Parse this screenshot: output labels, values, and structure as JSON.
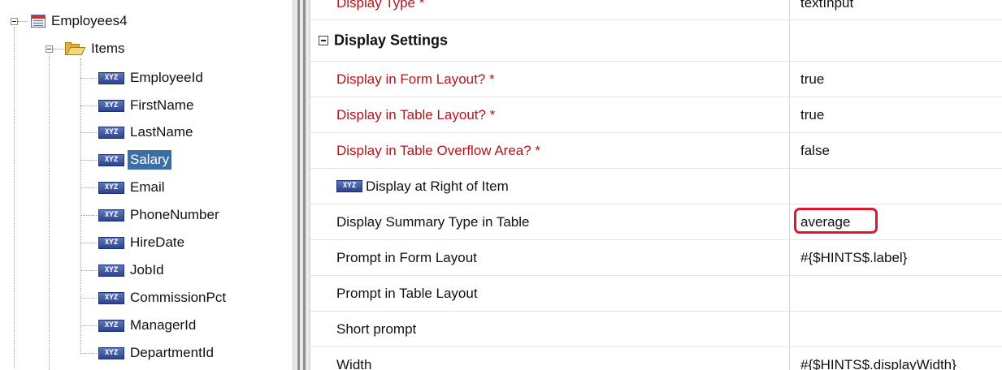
{
  "tree": {
    "root": {
      "label": "Employees4"
    },
    "folder": {
      "label": "Items"
    },
    "items": [
      {
        "label": "EmployeeId"
      },
      {
        "label": "FirstName"
      },
      {
        "label": "LastName"
      },
      {
        "label": "Salary",
        "selected": true
      },
      {
        "label": "Email"
      },
      {
        "label": "PhoneNumber"
      },
      {
        "label": "HireDate"
      },
      {
        "label": "JobId"
      },
      {
        "label": "CommissionPct"
      },
      {
        "label": "ManagerId"
      },
      {
        "label": "DepartmentId"
      }
    ]
  },
  "grid": {
    "top_partial": {
      "name": "Display Type *",
      "value": "textInput"
    },
    "section": {
      "label": "Display Settings"
    },
    "rows": [
      {
        "name": "Display in Form Layout? *",
        "value": "true",
        "required": true
      },
      {
        "name": "Display in Table Layout? *",
        "value": "true",
        "required": true
      },
      {
        "name": "Display in Table Overflow Area? *",
        "value": "false",
        "required": true
      },
      {
        "name": "Display at Right of Item",
        "value": "",
        "icon": "xyz-attribute-icon"
      },
      {
        "name": "Display Summary Type in Table",
        "value": "average",
        "highlighted": true
      },
      {
        "name": "Prompt in Form Layout",
        "value": "#{$HINTS$.label}"
      },
      {
        "name": "Prompt in Table Layout",
        "value": ""
      },
      {
        "name": "Short prompt",
        "value": ""
      },
      {
        "name": "Width",
        "value": "#{$HINTS$.displayWidth}"
      }
    ]
  },
  "colors": {
    "required_text": "#b0151d",
    "selection": "#3a6ea5",
    "highlight_border": "#e0162a"
  }
}
